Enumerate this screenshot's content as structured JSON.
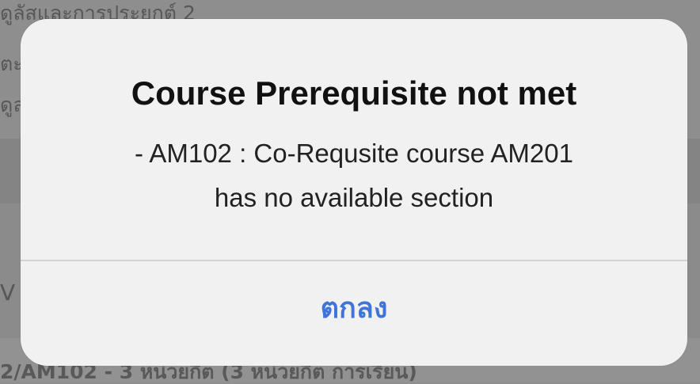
{
  "background": {
    "line1": "ดูลัสและการประยุกต์ 2",
    "line2": "ตะ",
    "line3": "ดูล",
    "line4": "V",
    "line5": "2/AM102 - 3 หน่วยกิต (3 หน่วยกิต การเรียน)"
  },
  "alert": {
    "title": "Course Prerequisite not met",
    "message_line1": "- AM102 : Co-Requsite course AM201",
    "message_line2": "has no available section",
    "ok_label": "ตกลง"
  },
  "colors": {
    "dialog_background": "#f1f1f1",
    "button_blue": "#3f74d8",
    "text_dark": "#111111",
    "separator": "#d3d3d3"
  }
}
